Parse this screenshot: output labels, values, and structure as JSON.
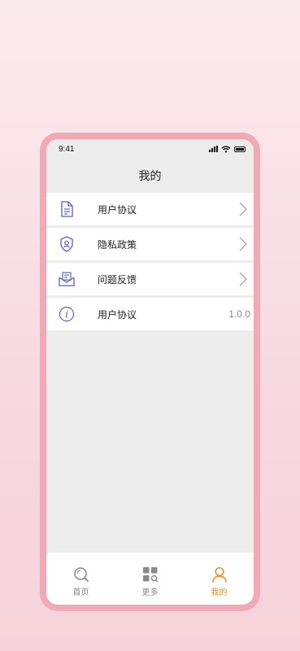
{
  "status_bar": {
    "time": "9:41"
  },
  "header": {
    "title": "我的"
  },
  "menu": {
    "items": [
      {
        "label": "用户协议",
        "icon": "document-icon"
      },
      {
        "label": "隐私政策",
        "icon": "shield-user-icon"
      },
      {
        "label": "问题反馈",
        "icon": "feedback-mail-icon"
      },
      {
        "label": "用户协议",
        "icon": "info-icon",
        "value": "1.0.0"
      }
    ]
  },
  "tabbar": {
    "tabs": [
      {
        "label": "首页",
        "icon": "search-icon"
      },
      {
        "label": "更多",
        "icon": "grid-search-icon"
      },
      {
        "label": "我的",
        "icon": "user-icon",
        "active": true
      }
    ]
  },
  "colors": {
    "accent": "#f08a1e",
    "icon": "#5b5fc7",
    "frame": "#f2a9b6"
  }
}
